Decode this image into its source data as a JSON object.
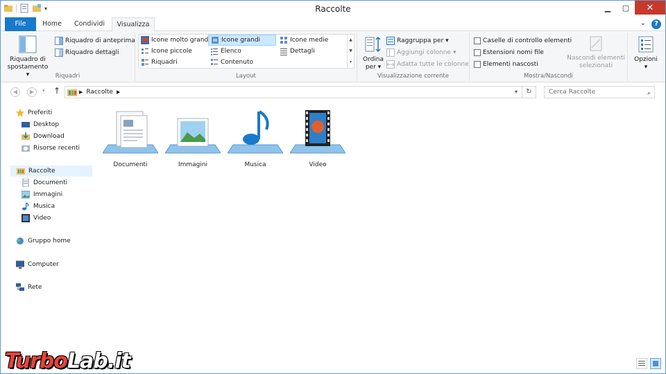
{
  "window": {
    "title": "Raccolte"
  },
  "tabs": [
    {
      "label": "File"
    },
    {
      "label": "Home"
    },
    {
      "label": "Condividi"
    },
    {
      "label": "Visualizza"
    }
  ],
  "ribbon": {
    "panes": {
      "nav_pane_line1": "Riquadro di",
      "nav_pane_line2": "spostamento",
      "preview": "Riquadro di anteprima",
      "details": "Riquadro dettagli",
      "group": "Riquadri"
    },
    "layout": {
      "items": [
        "Icone molto grandi",
        "Icone grandi",
        "Icone medie",
        "Icone piccole",
        "Elenco",
        "Dettagli",
        "Riquadri",
        "Contenuto"
      ],
      "group": "Layout"
    },
    "current_view": {
      "sort_line1": "Ordina",
      "sort_line2": "per",
      "group_by": "Raggruppa per",
      "add_columns": "Aggiungi colonne",
      "fit_columns": "Adatta tutte le colonne",
      "group": "Visualizzazione corrente"
    },
    "show_hide": {
      "item_checkboxes": "Caselle di controllo elementi",
      "file_extensions": "Estensioni nomi file",
      "hidden_items": "Elementi nascosti",
      "hide_selected_line1": "Nascondi elementi",
      "hide_selected_line2": "selezionati",
      "group": "Mostra/Nascondi"
    },
    "options": {
      "label": "Opzioni"
    }
  },
  "address": {
    "path": "Raccolte",
    "search_placeholder": "Cerca Raccolte"
  },
  "nav": {
    "favorites": "Preferiti",
    "desktop": "Desktop",
    "download": "Download",
    "recent": "Risorse recenti",
    "libraries": "Raccolte",
    "lib_documents": "Documenti",
    "lib_images": "Immagini",
    "lib_music": "Musica",
    "lib_video": "Video",
    "homegroup": "Gruppo home",
    "computer": "Computer",
    "network": "Rete"
  },
  "libraries": [
    "Documenti",
    "Immagini",
    "Musica",
    "Video"
  ],
  "watermark": {
    "part1": "Turbo",
    "part2": "Lab.it"
  },
  "colors": {
    "accent": "#1979ca",
    "close": "#c7382d",
    "selection": "#cce8ff"
  }
}
